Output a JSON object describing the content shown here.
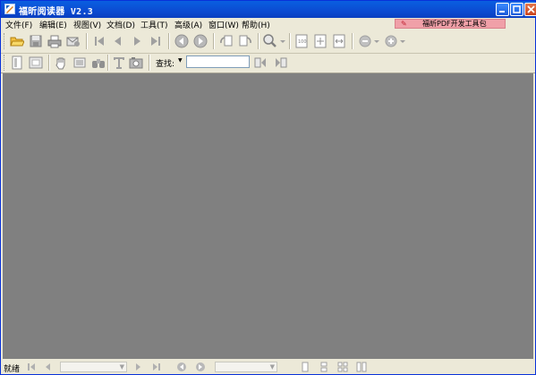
{
  "window": {
    "title": "福昕阅读器 V2.3"
  },
  "menu": [
    {
      "label": "文件(F)"
    },
    {
      "label": "编辑(E)"
    },
    {
      "label": "视图(V)"
    },
    {
      "label": "文档(D)"
    },
    {
      "label": "工具(T)"
    },
    {
      "label": "高级(A)"
    },
    {
      "label": "窗口(W)"
    },
    {
      "label": "帮助(H)"
    }
  ],
  "promo": {
    "label": "福昕PDF开发工具包"
  },
  "find": {
    "label": "查找:",
    "value": ""
  },
  "status": {
    "text": "就绪"
  },
  "colors": {
    "titlebar": "#0b4bd2",
    "document_background": "#808080",
    "chrome": "#ece9d8",
    "promo": "#f0a0a8"
  }
}
